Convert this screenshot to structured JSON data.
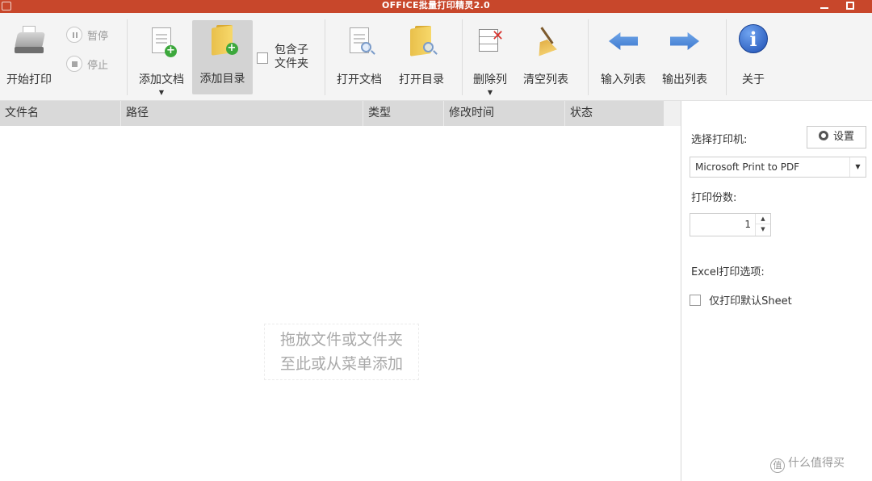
{
  "window": {
    "title": "OFFICE批量打印精灵2.0"
  },
  "toolbar": {
    "start_print": "开始打印",
    "pause": "暂停",
    "stop": "停止",
    "add_document": "添加文档",
    "add_directory": "添加目录",
    "include_subfolders_line1": "包含子",
    "include_subfolders_line2": "文件夹",
    "open_document": "打开文档",
    "open_directory": "打开目录",
    "delete_column": "删除列",
    "clear_list": "清空列表",
    "import_list": "输入列表",
    "export_list": "输出列表",
    "about": "关于",
    "dropdown_glyph": "▼"
  },
  "file_list": {
    "columns": [
      "文件名",
      "路径",
      "类型",
      "修改时间",
      "状态"
    ],
    "empty_hint_line1": "拖放文件或文件夹",
    "empty_hint_line2": "至此或从菜单添加"
  },
  "settings_panel": {
    "select_printer_label": "选择打印机:",
    "settings_button": "设置",
    "printer_value": "Microsoft Print to PDF",
    "copies_label": "打印份数:",
    "copies_value": "1",
    "excel_options_label": "Excel打印选项:",
    "only_default_sheet": "仅打印默认Sheet"
  },
  "watermark": {
    "icon_text": "值",
    "text": "什么值得买"
  },
  "colors": {
    "title_bar": "#c8472b",
    "ribbon_bg": "#f4f4f4",
    "header_bg": "#d9d9d9",
    "active_tool": "#d3d3d3"
  },
  "icons": {
    "start_print": "printer-icon",
    "pause": "pause-icon",
    "stop": "stop-icon",
    "add_document": "add-document-icon",
    "add_directory": "add-folder-icon",
    "open_document": "open-document-icon",
    "open_directory": "open-folder-icon",
    "delete_column": "delete-column-icon",
    "clear_list": "broom-icon",
    "import_list": "arrow-left-icon",
    "export_list": "arrow-right-icon",
    "about": "info-icon",
    "settings": "gear-icon"
  }
}
